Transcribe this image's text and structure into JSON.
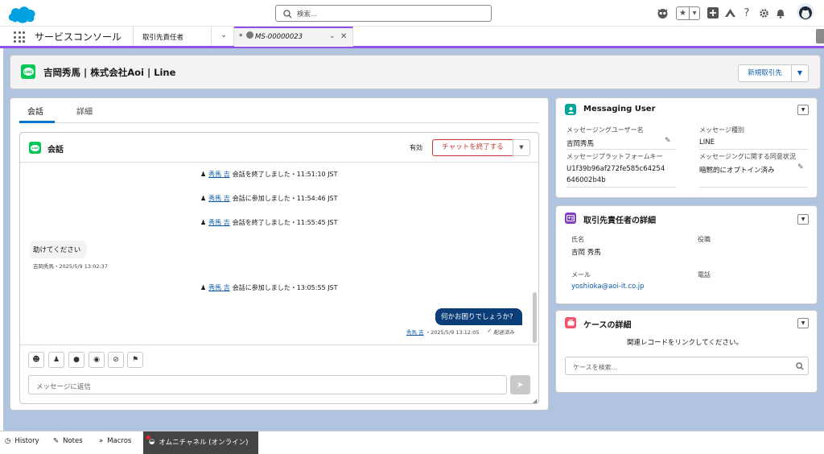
{
  "search": {
    "placeholder": "検索..."
  },
  "app": {
    "name": "サービスコンソール"
  },
  "tabs": [
    {
      "label": "取引先責任者"
    },
    {
      "label": "MS-00000023",
      "dirty_marker": "*"
    }
  ],
  "header": {
    "title": "吉岡秀馬 | 株式会社Aoi | Line",
    "new_button": "新規取引先",
    "icon_text": "LINE"
  },
  "conversation": {
    "tabs": [
      "会話",
      "詳細"
    ],
    "title": "会話",
    "status": "有効",
    "end_button": "チャットを終了する",
    "events": [
      {
        "user": "秀馬 吉",
        "text": "会話を終了しました・11:51:10 JST"
      },
      {
        "user": "秀馬 吉",
        "text": "会話に参加しました・11:54:46 JST"
      },
      {
        "user": "秀馬 吉",
        "text": "会話を終了しました・11:55:45 JST"
      },
      {
        "user": "秀馬 吉",
        "text": "会話に参加しました・13:05:55 JST"
      }
    ],
    "incoming": {
      "text": "助けてください",
      "meta": "吉岡秀馬・2025/5/9 13:02:37"
    },
    "outgoing": {
      "text": "何かお困りでしょうか?",
      "user": "秀馬 吉",
      "meta": "・2025/5/9 13:12:05",
      "status": "配送済み"
    },
    "input_placeholder": "メッセージに返信"
  },
  "messaging_user": {
    "title": "Messaging User",
    "fields": [
      {
        "label": "メッセージングユーザー名",
        "value": "吉岡秀馬"
      },
      {
        "label": "メッセージ種別",
        "value": "LINE"
      },
      {
        "label": "メッセージプラットフォームキー",
        "value": "U1f39b96af272fe585c64254",
        "value2": "646002b4b"
      },
      {
        "label": "メッセージングに関する同意状況",
        "value": "暗黙的にオプトイン済み"
      }
    ]
  },
  "contact_details": {
    "title": "取引先責任者の詳細",
    "name_label": "氏名",
    "name_value": "吉岡 秀馬",
    "role_label": "役職",
    "email_label": "メール",
    "email_value": "yoshioka@aoi-it.co.jp",
    "phone_label": "電話"
  },
  "case_details": {
    "title": "ケースの詳細",
    "message": "関連レコードをリンクしてください。",
    "search_placeholder": "ケースを検索..."
  },
  "utility_bar": {
    "history": "History",
    "notes": "Notes",
    "macros": "Macros",
    "omni": "オムニチャネル (オンライン)"
  },
  "colors": {
    "brand": "#0176d3",
    "line_green": "#06c755",
    "tab_accent": "#9050e9",
    "outgoing_bubble": "#0b3d78",
    "end_button": "#c23934"
  }
}
